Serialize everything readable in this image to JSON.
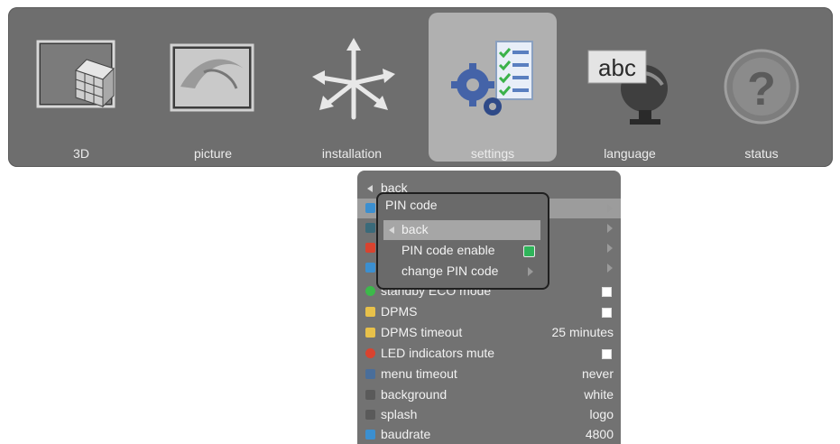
{
  "tabs": [
    {
      "label": "3D",
      "icon": "rubiks-cube-icon",
      "selected": false
    },
    {
      "label": "picture",
      "icon": "picture-frame-icon",
      "selected": false
    },
    {
      "label": "installation",
      "icon": "move-arrows-icon",
      "selected": false
    },
    {
      "label": "settings",
      "icon": "gears-checklist-icon",
      "selected": true
    },
    {
      "label": "language",
      "icon": "abc-globe-icon",
      "selected": false
    },
    {
      "label": "status",
      "icon": "question-mark-icon",
      "selected": false
    }
  ],
  "menu": {
    "back_label": "back",
    "items": [
      {
        "label": "standby ECO mode",
        "value": "",
        "checkbox": true,
        "icon": "power-icon",
        "icon_color": "#3cb94a"
      },
      {
        "label": "DPMS",
        "value": "",
        "checkbox": true,
        "icon": "monitor-icon",
        "icon_color": "#e8c14a"
      },
      {
        "label": "DPMS timeout",
        "value": "25 minutes",
        "checkbox": false,
        "icon": "timer-icon",
        "icon_color": "#e8c14a"
      },
      {
        "label": "LED indicators mute",
        "value": "",
        "checkbox": true,
        "icon": "led-icon",
        "icon_color": "#d9432f"
      },
      {
        "label": "menu timeout",
        "value": "never",
        "checkbox": false,
        "icon": "clock-icon",
        "icon_color": "#4a6e9a"
      },
      {
        "label": "background",
        "value": "white",
        "checkbox": false,
        "icon": "background-icon",
        "icon_color": "#5a5a5a"
      },
      {
        "label": "splash",
        "value": "logo",
        "checkbox": false,
        "icon": "splash-icon",
        "icon_color": "#5a5a5a"
      },
      {
        "label": "baudrate",
        "value": "4800",
        "checkbox": false,
        "icon": "baudrate-icon",
        "icon_color": "#3b8fd0"
      }
    ]
  },
  "pin_submenu": {
    "title": "PIN code",
    "back_label": "back",
    "enable_label": "PIN code enable",
    "enable_checked": true,
    "change_label": "change PIN code"
  },
  "colors": {
    "bar_bg": "#6e6e6e",
    "selected_tab_bg": "#b0b0b0",
    "menu_bg": "#727272"
  }
}
